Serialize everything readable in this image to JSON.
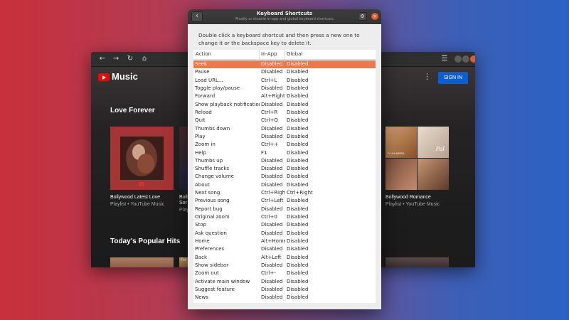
{
  "main_window": {
    "header": {
      "back_icon": "arrow-left-icon",
      "forward_icon": "arrow-right-icon",
      "reload_icon": "reload-icon",
      "home_icon": "home-icon",
      "menu_icon": "hamburger-menu-icon"
    },
    "brand": {
      "name": "Music",
      "logo_icon": "youtube-play-icon",
      "logo_color": "#ff0000"
    },
    "sign_in_label": "SIGN IN",
    "sign_in_color": "#065fd4",
    "sections": [
      {
        "title": "Love Forever",
        "cards": [
          {
            "title": "Bollywood Latest Love",
            "subtitle": "Playlist • YouTube Music"
          },
          {
            "title": "Boll",
            "subtitle": "Play"
          },
          {
            "title": "Sor",
            "subtitle": ""
          },
          {
            "title": "Bollywood Romance",
            "subtitle": "Playlist • YouTube Music"
          }
        ]
      },
      {
        "title": "Today's Popular Hits"
      }
    ],
    "art_text": {
      "tile_a": "TU HA MERA",
      "tile_b": "Pal",
      "peek_text": "Tu"
    }
  },
  "dialog": {
    "title": "Keyboard Shortcuts",
    "subtitle": "Modify or disable in-app and global keyboard shortcuts",
    "instructions": "Double click a keyboard shortcut and then press a new one to change it or the backspace key to delete it.",
    "accent_color": "#f07746",
    "columns": [
      "Action",
      "In-App",
      "Global"
    ],
    "rows": [
      {
        "action": "Seek",
        "in_app": "Disabled",
        "global": "Disabled",
        "selected": true
      },
      {
        "action": "Pause",
        "in_app": "Disabled",
        "global": "Disabled"
      },
      {
        "action": "Load URL...",
        "in_app": "Ctrl+L",
        "global": "Disabled"
      },
      {
        "action": "Toggle play/pause",
        "in_app": "Disabled",
        "global": "Disabled"
      },
      {
        "action": "Forward",
        "in_app": "Alt+Right",
        "global": "Disabled"
      },
      {
        "action": "Show playback notification",
        "in_app": "Disabled",
        "global": "Disabled"
      },
      {
        "action": "Reload",
        "in_app": "Ctrl+R",
        "global": "Disabled"
      },
      {
        "action": "Quit",
        "in_app": "Ctrl+Q",
        "global": "Disabled"
      },
      {
        "action": "Thumbs down",
        "in_app": "Disabled",
        "global": "Disabled"
      },
      {
        "action": "Play",
        "in_app": "Disabled",
        "global": "Disabled"
      },
      {
        "action": "Zoom in",
        "in_app": "Ctrl++",
        "global": "Disabled"
      },
      {
        "action": "Help",
        "in_app": "F1",
        "global": "Disabled"
      },
      {
        "action": "Thumbs up",
        "in_app": "Disabled",
        "global": "Disabled"
      },
      {
        "action": "Shuffle tracks",
        "in_app": "Disabled",
        "global": "Disabled"
      },
      {
        "action": "Change volume",
        "in_app": "Disabled",
        "global": "Disabled"
      },
      {
        "action": "About",
        "in_app": "Disabled",
        "global": "Disabled"
      },
      {
        "action": "Next song",
        "in_app": "Ctrl+Right",
        "global": "Ctrl+Right"
      },
      {
        "action": "Previous song",
        "in_app": "Ctrl+Left",
        "global": "Disabled"
      },
      {
        "action": "Report bug",
        "in_app": "Disabled",
        "global": "Disabled"
      },
      {
        "action": "Original zoom",
        "in_app": "Ctrl+0",
        "global": "Disabled"
      },
      {
        "action": "Stop",
        "in_app": "Disabled",
        "global": "Disabled"
      },
      {
        "action": "Ask question",
        "in_app": "Disabled",
        "global": "Disabled"
      },
      {
        "action": "Home",
        "in_app": "Alt+Home",
        "global": "Disabled"
      },
      {
        "action": "Preferences",
        "in_app": "Disabled",
        "global": "Disabled"
      },
      {
        "action": "Back",
        "in_app": "Alt+Left",
        "global": "Disabled"
      },
      {
        "action": "Show sidebar",
        "in_app": "Disabled",
        "global": "Disabled"
      },
      {
        "action": "Zoom out",
        "in_app": "Ctrl+-",
        "global": "Disabled"
      },
      {
        "action": "Activate main window",
        "in_app": "Disabled",
        "global": "Disabled"
      },
      {
        "action": "Suggest feature",
        "in_app": "Disabled",
        "global": "Disabled"
      },
      {
        "action": "News",
        "in_app": "Disabled",
        "global": "Disabled"
      }
    ],
    "icons": {
      "back": "chevron-left-icon",
      "settings": "settings-icon",
      "close": "close-icon"
    }
  }
}
